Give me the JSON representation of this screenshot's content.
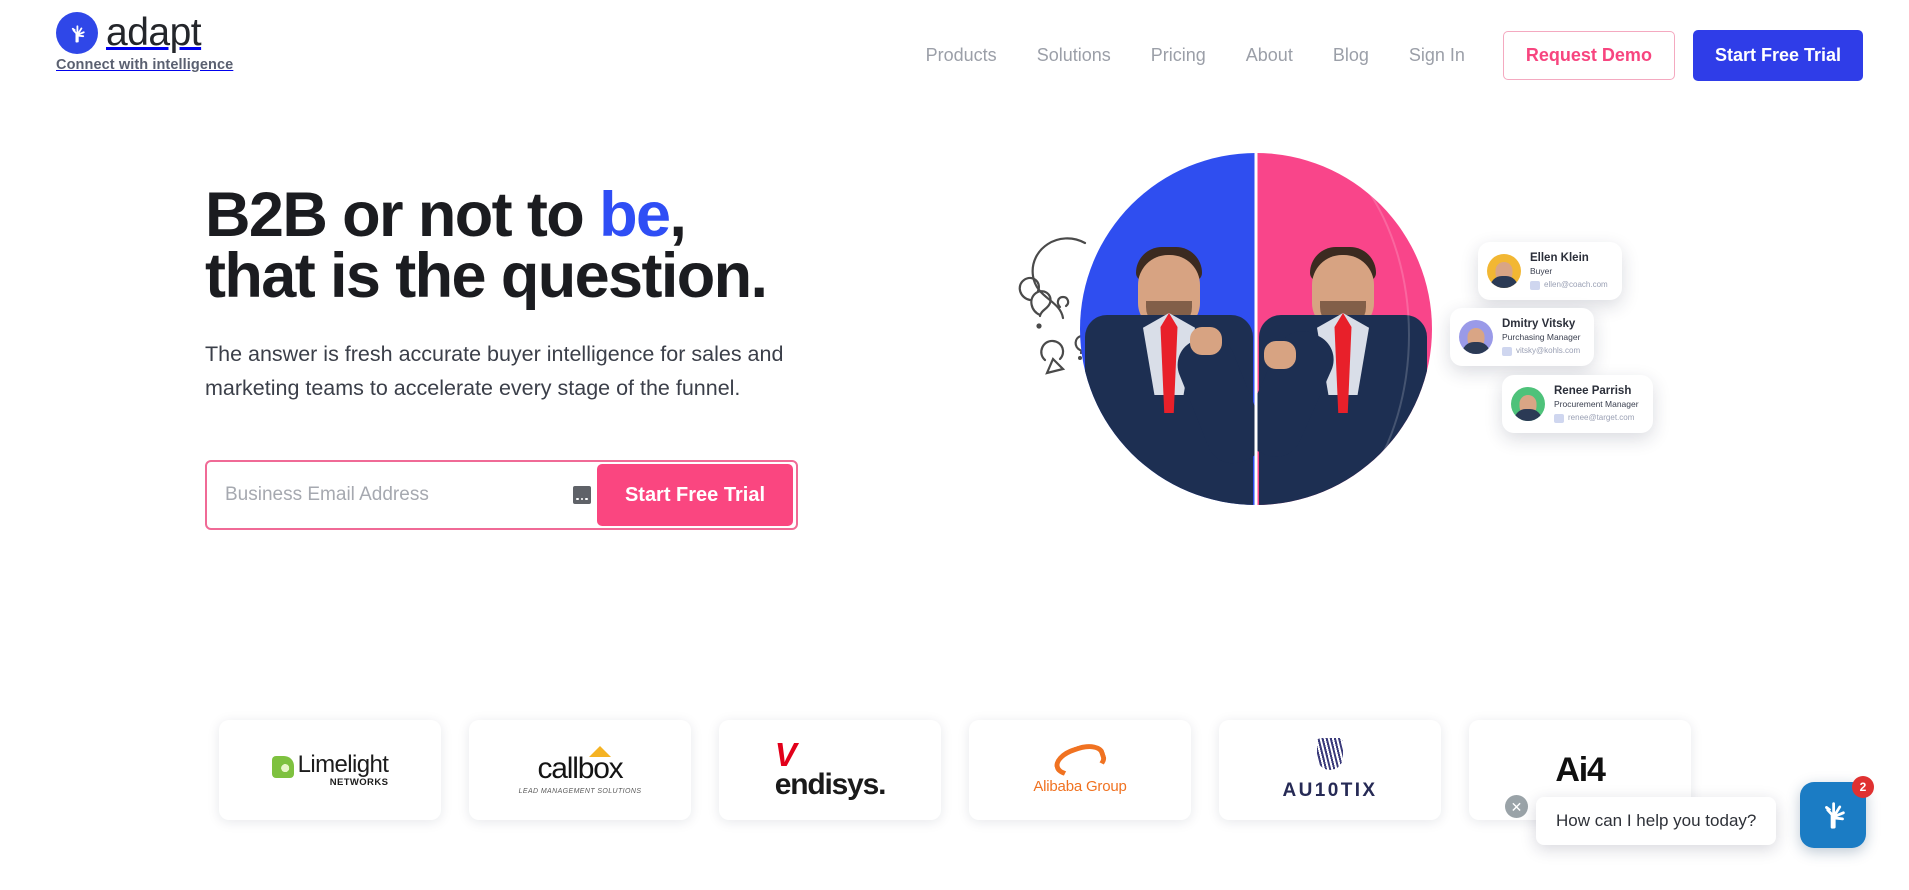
{
  "brand": {
    "name": "adapt",
    "tagline": "Connect with intelligence",
    "logo_icon": "adapt-tree-hand-icon",
    "logo_color": "#2f47e8"
  },
  "nav": {
    "links": [
      {
        "label": "Products"
      },
      {
        "label": "Solutions"
      },
      {
        "label": "Pricing"
      },
      {
        "label": "About"
      },
      {
        "label": "Blog"
      },
      {
        "label": "Sign In"
      }
    ],
    "demo_button": {
      "label": "Request Demo",
      "color": "#f7457f"
    },
    "trial_button": {
      "label": "Start Free Trial",
      "color": "#2f3de8"
    }
  },
  "hero": {
    "title_line1_a": "B2B or not to ",
    "title_accent": "be",
    "title_line1_b": ",",
    "title_line2": "that is the question.",
    "accent_color": "#2f4ef5",
    "subtitle": "The answer is fresh accurate buyer intelligence for sales and marketing teams to accelerate every stage of the funnel.",
    "form": {
      "placeholder": "Business Email Address",
      "value": "",
      "more_icon": "ellipsis-icon",
      "submit_label": "Start Free Trial",
      "submit_color": "#fa4680",
      "border_color": "#f06a96"
    },
    "art": {
      "left_half_color": "#2f4ef0",
      "right_half_color": "#f9458a",
      "doodle_icon": "question-mark-doodles"
    },
    "contacts": [
      {
        "name": "Ellen Klein",
        "role": "Buyer",
        "email": "ellen@coach.com",
        "avatar_bg": "#f2b733"
      },
      {
        "name": "Dmitry Vitsky",
        "role": "Purchasing Manager",
        "email": "vitsky@kohls.com",
        "avatar_bg": "#9a9ae8"
      },
      {
        "name": "Renee Parrish",
        "role": "Procurement Manager",
        "email": "renee@target.com",
        "avatar_bg": "#4ec27a"
      }
    ]
  },
  "logos": [
    {
      "name": "Limelight",
      "sub": "NETWORKS"
    },
    {
      "name": "callbox",
      "sub": "LEAD MANAGEMENT SOLUTIONS"
    },
    {
      "name_v": "V",
      "name_rest": "endisys.",
      "sub": ""
    },
    {
      "name": "Alibaba",
      "name_light": " Group",
      "sub": ""
    },
    {
      "name": "AU10TIX",
      "sub": ""
    },
    {
      "name": "Ai4",
      "sub": ""
    }
  ],
  "chat": {
    "message": "How can I help you today?",
    "badge_count": "2",
    "close_icon": "close-icon",
    "launcher_icon": "adapt-tree-hand-icon",
    "launcher_color": "#1b7cc4",
    "badge_color": "#e03131"
  }
}
